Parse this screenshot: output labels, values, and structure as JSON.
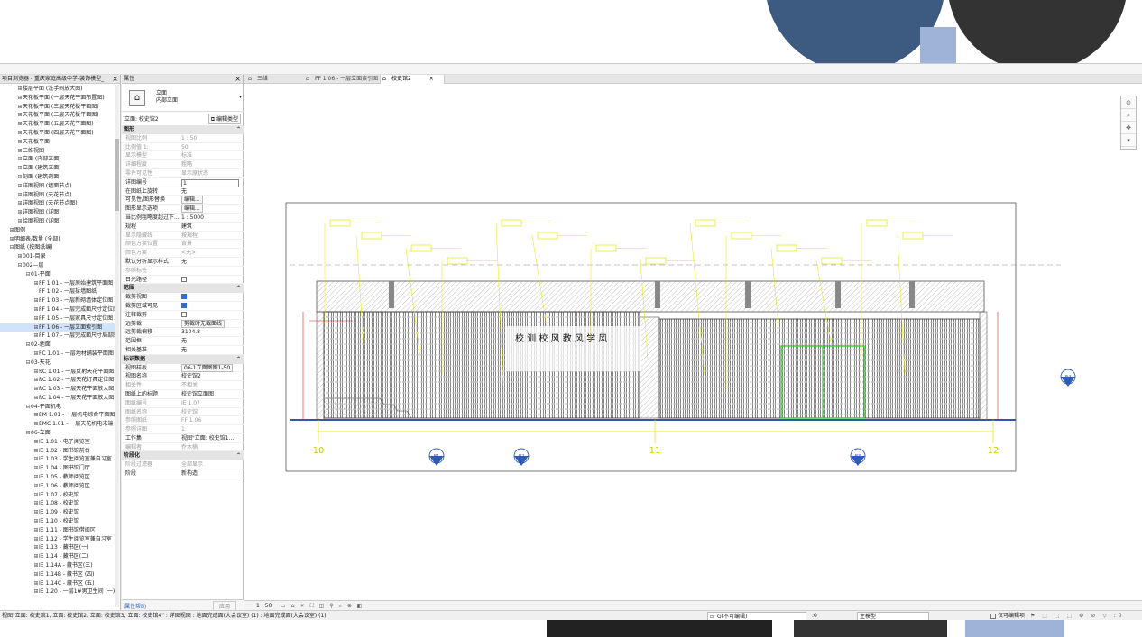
{
  "project_browser": {
    "title": "项目浏览器 - 重庆家庭高级中学-装饰模型_",
    "items": [
      {
        "indent": 1,
        "toggle": "⊞",
        "label": "楼层平面 (洗手间放大图)"
      },
      {
        "indent": 1,
        "toggle": "⊞",
        "label": "天花板平面 (一层天花平面布置图)"
      },
      {
        "indent": 1,
        "toggle": "⊞",
        "label": "天花板平面 (三层天花板平面图)"
      },
      {
        "indent": 1,
        "toggle": "⊞",
        "label": "天花板平面 (二层天花板平面图)"
      },
      {
        "indent": 1,
        "toggle": "⊞",
        "label": "天花板平面 (五层天花平面图)"
      },
      {
        "indent": 1,
        "toggle": "⊞",
        "label": "天花板平面 (四层天花平面图)"
      },
      {
        "indent": 1,
        "toggle": "⊞",
        "label": "天花板平面"
      },
      {
        "indent": 1,
        "toggle": "⊞",
        "label": "三维视图"
      },
      {
        "indent": 1,
        "toggle": "⊞",
        "label": "立面 (内部立面)"
      },
      {
        "indent": 1,
        "toggle": "⊞",
        "label": "立面 (建筑立面)"
      },
      {
        "indent": 1,
        "toggle": "⊞",
        "label": "剖面 (建筑剖面)"
      },
      {
        "indent": 1,
        "toggle": "⊞",
        "label": "详图视图 (墙面节点)"
      },
      {
        "indent": 1,
        "toggle": "⊞",
        "label": "详图视图 (天花节点)"
      },
      {
        "indent": 1,
        "toggle": "⊞",
        "label": "详图视图 (天花节点图)"
      },
      {
        "indent": 1,
        "toggle": "⊞",
        "label": "详图视图 (详图)"
      },
      {
        "indent": 1,
        "toggle": "⊞",
        "label": "绘图视图 (详图)"
      },
      {
        "indent": 0,
        "toggle": "⊞",
        "label": "图例"
      },
      {
        "indent": 0,
        "toggle": "⊞",
        "label": "明细表/数量 (全部)"
      },
      {
        "indent": 0,
        "toggle": "⊟",
        "label": "图纸 (按图纸编)"
      },
      {
        "indent": 1,
        "toggle": "⊞",
        "label": "001-目录"
      },
      {
        "indent": 1,
        "toggle": "⊟",
        "label": "002—层"
      },
      {
        "indent": 2,
        "toggle": "⊟",
        "label": "01-平面"
      },
      {
        "indent": 3,
        "toggle": "⊞",
        "label": "FF 1.01 - 一层原始建筑平面图"
      },
      {
        "indent": 3,
        "toggle": "",
        "label": "FF 1.02 - 一层拆墙图纸"
      },
      {
        "indent": 3,
        "toggle": "⊞",
        "label": "FF 1.03 - 一层新砌墙体定位图"
      },
      {
        "indent": 3,
        "toggle": "⊞",
        "label": "FF 1.04 - 一层完成面尺寸定位图"
      },
      {
        "indent": 3,
        "toggle": "⊞",
        "label": "FF 1.05 - 一层家具尺寸定位图"
      },
      {
        "indent": 3,
        "toggle": "⊞",
        "label": "FF 1.06 - 一层立面索引图",
        "selected": true
      },
      {
        "indent": 3,
        "toggle": "⊞",
        "label": "FF 1.07 - 一层完成面尺寸局部图"
      },
      {
        "indent": 2,
        "toggle": "⊟",
        "label": "02-地面"
      },
      {
        "indent": 3,
        "toggle": "⊞",
        "label": "FC 1.01 - 一层地材铺装平面图"
      },
      {
        "indent": 2,
        "toggle": "⊟",
        "label": "03-天花"
      },
      {
        "indent": 3,
        "toggle": "⊞",
        "label": "RC 1.01 - 一层反射天花平面图"
      },
      {
        "indent": 3,
        "toggle": "⊞",
        "label": "RC 1.02 - 一层天花灯具定位图"
      },
      {
        "indent": 3,
        "toggle": "⊞",
        "label": "RC 1.03 - 一层天花平面放大图"
      },
      {
        "indent": 3,
        "toggle": "⊞",
        "label": "RC 1.04 - 一层天花平面放大图"
      },
      {
        "indent": 2,
        "toggle": "⊟",
        "label": "04-平面机电"
      },
      {
        "indent": 3,
        "toggle": "⊞",
        "label": "EM 1.01 - 一层机电综合平面图"
      },
      {
        "indent": 3,
        "toggle": "⊞",
        "label": "EMC 1.01 - 一层天花机电末端"
      },
      {
        "indent": 2,
        "toggle": "⊟",
        "label": "06-立面"
      },
      {
        "indent": 3,
        "toggle": "⊞",
        "label": "IE 1.01 - 电子阅览室"
      },
      {
        "indent": 3,
        "toggle": "⊞",
        "label": "IE 1.02 - 图书馆前台"
      },
      {
        "indent": 3,
        "toggle": "⊞",
        "label": "IE 1.03 - 学生阅览室兼自习室"
      },
      {
        "indent": 3,
        "toggle": "⊞",
        "label": "IE 1.04 - 图书馆门厅"
      },
      {
        "indent": 3,
        "toggle": "⊞",
        "label": "IE 1.05 - 教师阅览区"
      },
      {
        "indent": 3,
        "toggle": "⊞",
        "label": "IE 1.06 - 教师阅览区"
      },
      {
        "indent": 3,
        "toggle": "⊞",
        "label": "IE 1.07 - 校史馆"
      },
      {
        "indent": 3,
        "toggle": "⊞",
        "label": "IE 1.08 - 校史馆"
      },
      {
        "indent": 3,
        "toggle": "⊞",
        "label": "IE 1.09 - 校史馆"
      },
      {
        "indent": 3,
        "toggle": "⊞",
        "label": "IE 1.10 - 校史馆"
      },
      {
        "indent": 3,
        "toggle": "⊞",
        "label": "IE 1.11 - 图书馆借阅区"
      },
      {
        "indent": 3,
        "toggle": "⊞",
        "label": "IE 1.12 - 学生阅览室兼自习室"
      },
      {
        "indent": 3,
        "toggle": "⊞",
        "label": "IE 1.13 - 藏书区(一)"
      },
      {
        "indent": 3,
        "toggle": "⊞",
        "label": "IE 1.14 - 藏书区(二)"
      },
      {
        "indent": 3,
        "toggle": "⊞",
        "label": "IE 1.14A - 藏书区(三)"
      },
      {
        "indent": 3,
        "toggle": "⊞",
        "label": "IE 1.14B - 藏书区 (四)"
      },
      {
        "indent": 3,
        "toggle": "⊞",
        "label": "IE 1.14C - 藏书区 (五)"
      },
      {
        "indent": 3,
        "toggle": "⊞",
        "label": "IE 1.20 - 一层1#男卫生间 (一)"
      }
    ]
  },
  "properties": {
    "title": "属性",
    "type_name_1": "立面",
    "type_name_2": "内部立面",
    "instance_label": "立面: 校史馆2",
    "edit_type": "编辑类型",
    "help": "属性帮助",
    "apply": "应用",
    "groups": [
      {
        "name": "图形",
        "rows": [
          {
            "k": "视图比例",
            "v": "1 : 50",
            "dim": true
          },
          {
            "k": "比例值 1:",
            "v": "50",
            "dim": true
          },
          {
            "k": "显示模型",
            "v": "标准",
            "dim": true
          },
          {
            "k": "详细程度",
            "v": "粗略",
            "dim": true
          },
          {
            "k": "零件可见性",
            "v": "显示原状态",
            "dim": true
          },
          {
            "k": "详图编号",
            "v": "1",
            "input": true
          },
          {
            "k": "在图纸上旋转",
            "v": "无"
          },
          {
            "k": "可见性/图形替换",
            "v": "编辑...",
            "button": true
          },
          {
            "k": "图形显示选项",
            "v": "编辑...",
            "button": true
          },
          {
            "k": "当比例粗略度超过下...",
            "v": "1 : 5000"
          },
          {
            "k": "规程",
            "v": "建筑"
          },
          {
            "k": "显示隐藏线",
            "v": "按规程",
            "dim": true
          },
          {
            "k": "颜色方案位置",
            "v": "背景",
            "dim": true
          },
          {
            "k": "颜色方案",
            "v": "<无>",
            "dim": true
          },
          {
            "k": "默认分析显示样式",
            "v": "无"
          },
          {
            "k": "参照标签",
            "v": "",
            "dim": true
          },
          {
            "k": "日光路径",
            "v": "",
            "check": false
          }
        ]
      },
      {
        "name": "范围",
        "rows": [
          {
            "k": "裁剪视图",
            "v": "",
            "check": true
          },
          {
            "k": "裁剪区域可见",
            "v": "",
            "check": true
          },
          {
            "k": "注释裁剪",
            "v": "",
            "check": false
          },
          {
            "k": "远剪裁",
            "v": "剪裁时无截面线",
            "button": true
          },
          {
            "k": "远剪裁偏移",
            "v": "3104.8"
          },
          {
            "k": "范围框",
            "v": "无"
          },
          {
            "k": "相关基准",
            "v": "无"
          }
        ]
      },
      {
        "name": "标识数据",
        "rows": [
          {
            "k": "视图样板",
            "v": "06-1立面图图1-50",
            "button": true
          },
          {
            "k": "视图名称",
            "v": "校史馆2"
          },
          {
            "k": "相关性",
            "v": "不相关",
            "dim": true
          },
          {
            "k": "图纸上的标题",
            "v": "校史馆立面图"
          },
          {
            "k": "图纸编号",
            "v": "IE 1.07",
            "dim": true
          },
          {
            "k": "图纸名称",
            "v": "校史馆",
            "dim": true
          },
          {
            "k": "参照图纸",
            "v": "FF 1.06",
            "dim": true
          },
          {
            "k": "参照详图",
            "v": "1",
            "dim": true
          },
          {
            "k": "工作集",
            "v": "视图\"立面: 校史馆1..."
          },
          {
            "k": "编辑者",
            "v": "乔木楠",
            "dim": true
          }
        ]
      },
      {
        "name": "阶段化",
        "rows": [
          {
            "k": "阶段过滤器",
            "v": "全部显示",
            "dim": true
          },
          {
            "k": "阶段",
            "v": "新构造"
          }
        ]
      }
    ]
  },
  "tabs": [
    {
      "label": "三维",
      "active": false
    },
    {
      "label": "FF 1.06 - 一层立面索引图",
      "active": false
    },
    {
      "label": "校史馆2",
      "active": true
    }
  ],
  "drawing": {
    "grid_labels": [
      "10",
      "11",
      "12"
    ],
    "marks": [
      "B1",
      "B2",
      "B3",
      "B4"
    ],
    "wall_text": "校 训 校 风 教 风 学 风"
  },
  "viewbar": {
    "scale": "1 : 50",
    "icons": "▭ ⌂ ☀ ⛶ ◫ ⚲ ⌕ ⊕ ◧"
  },
  "statusbar": {
    "message": "视图\"立面: 校史馆1, 立面: 校史馆2, 立面: 校史馆3, 立面: 校史馆4\" : 详图视图 : 地面完成面(大会议室) (1) : 地面完成面(大会议室) (1)",
    "workset": "G(不可编辑)",
    "zero": ":0",
    "model": "主模型",
    "editable_only": "仅可编辑项",
    "icons": "⚑ ⬚ ⬚ ⬚ ⚙ ⊘ ▽ :0"
  },
  "colors": {
    "accent": "#2f6fd6",
    "cad_yellow": "#e6e600",
    "cad_green": "#33cc33",
    "cad_red": "#e02020"
  }
}
